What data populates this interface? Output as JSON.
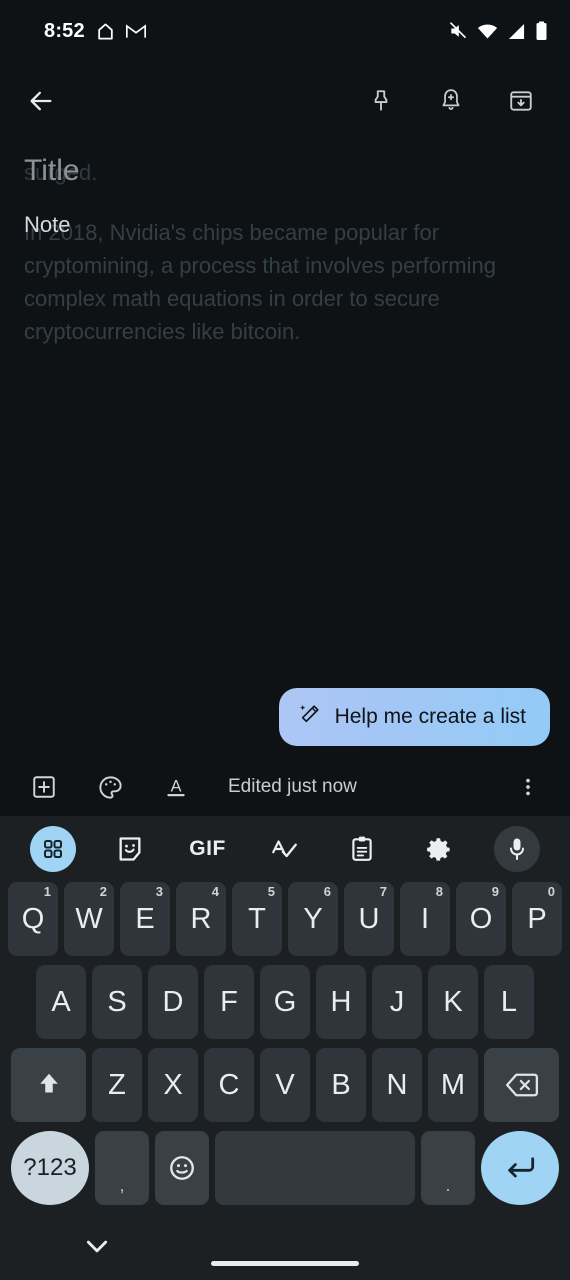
{
  "status_bar": {
    "time": "8:52",
    "left_icons": [
      "home-app-icon",
      "gmail-icon"
    ],
    "right_icons": [
      "vibrate-off-icon",
      "wifi-icon",
      "cellular-signal-icon",
      "battery-icon"
    ]
  },
  "app_bar": {
    "back": "back-arrow-icon",
    "actions": [
      {
        "name": "pin-icon",
        "label": "Pin"
      },
      {
        "name": "reminder-bell-icon",
        "label": "Remind me"
      },
      {
        "name": "archive-icon",
        "label": "Archive"
      }
    ]
  },
  "note": {
    "title_placeholder": "Title",
    "body_placeholder": "Note",
    "ghost_title": "surged.",
    "ghost_body": "In 2018, Nvidia's chips became popular for cryptomining, a process that involves performing complex math equations in order to secure cryptocurrencies like bitcoin."
  },
  "suggestion_chip": {
    "label": "Help me create a list",
    "icon": "magic-wand-icon",
    "gradient_start": "#aec7f4",
    "gradient_end": "#93cbf6",
    "text_color": "#101418"
  },
  "note_toolbar": {
    "add_label": "add-box-icon",
    "palette_label": "color-palette-icon",
    "format_label": "text-format-icon",
    "edited_status": "Edited just now",
    "overflow_label": "more-options-icon"
  },
  "keyboard": {
    "toolbar": [
      {
        "name": "grid-apps-icon",
        "active": true
      },
      {
        "name": "sticker-icon",
        "active": false
      },
      {
        "name": "gif-icon",
        "label": "GIF",
        "active": false
      },
      {
        "name": "spellcheck-icon",
        "active": false
      },
      {
        "name": "clipboard-icon",
        "active": false
      },
      {
        "name": "settings-gear-icon",
        "active": false
      },
      {
        "name": "microphone-icon",
        "active": false
      }
    ],
    "row1": [
      {
        "key": "Q",
        "num": "1"
      },
      {
        "key": "W",
        "num": "2"
      },
      {
        "key": "E",
        "num": "3"
      },
      {
        "key": "R",
        "num": "4"
      },
      {
        "key": "T",
        "num": "5"
      },
      {
        "key": "Y",
        "num": "6"
      },
      {
        "key": "U",
        "num": "7"
      },
      {
        "key": "I",
        "num": "8"
      },
      {
        "key": "O",
        "num": "9"
      },
      {
        "key": "P",
        "num": "0"
      }
    ],
    "row2": [
      "A",
      "S",
      "D",
      "F",
      "G",
      "H",
      "J",
      "K",
      "L"
    ],
    "row3": [
      "Z",
      "X",
      "C",
      "V",
      "B",
      "N",
      "M"
    ],
    "shift_label": "shift-icon",
    "backspace_label": "backspace-icon",
    "row4": {
      "symbols": "?123",
      "comma": ",",
      "emoji": "emoji-icon",
      "space": "",
      "period": ".",
      "enter": "enter-icon"
    },
    "accent_color": "#9fd4f5",
    "key_color": "#2f353a",
    "background": "#1c2023"
  },
  "nav_bar": {
    "hide_keyboard": "chevron-down-icon",
    "home_indicator": "home-gesture-bar"
  }
}
